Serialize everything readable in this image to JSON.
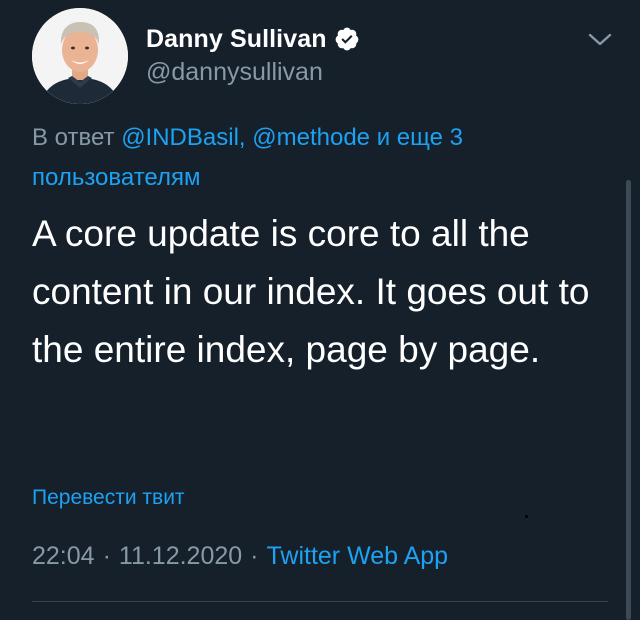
{
  "author": {
    "display_name": "Danny Sullivan",
    "handle": "@dannysullivan",
    "verified": true
  },
  "reply": {
    "prefix": "В ответ",
    "mentions": [
      "@INDBasil,",
      "@methode"
    ],
    "suffix_prefix": "и еще 3",
    "suffix_rest": "пользователям"
  },
  "tweet": {
    "text": "A core update is core to all the content in our index. It goes out to the entire index, page by page."
  },
  "translate_label": "Перевести твит",
  "meta": {
    "time": "22:04",
    "date": "11.12.2020",
    "separator": "·",
    "source": "Twitter Web App"
  },
  "icons": {
    "verified": "verified-badge-icon",
    "caret": "chevron-down-icon",
    "avatar": "profile-photo"
  },
  "colors": {
    "background": "#15202b",
    "accent": "#1da1f2",
    "secondary_text": "#8899a6",
    "primary_text": "#ffffff",
    "divider": "#38444d"
  }
}
